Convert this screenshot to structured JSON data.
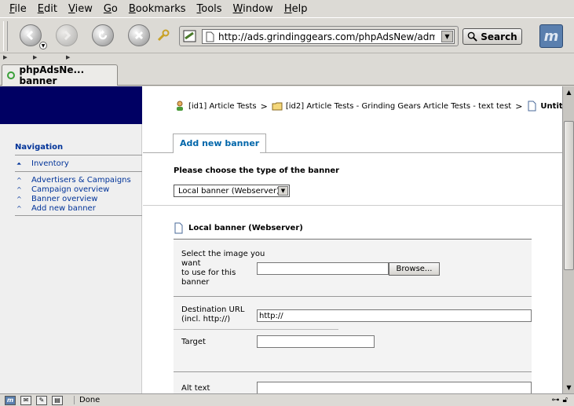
{
  "menu": {
    "items": [
      {
        "label": "File",
        "ul": "F",
        "rest": "ile"
      },
      {
        "label": "Edit",
        "ul": "E",
        "rest": "dit"
      },
      {
        "label": "View",
        "ul": "V",
        "rest": "iew"
      },
      {
        "label": "Go",
        "ul": "G",
        "rest": "o"
      },
      {
        "label": "Bookmarks",
        "ul": "B",
        "rest": "ookmarks"
      },
      {
        "label": "Tools",
        "ul": "T",
        "rest": "ools"
      },
      {
        "label": "Window",
        "ul": "W",
        "rest": "indow"
      },
      {
        "label": "Help",
        "ul": "H",
        "rest": "elp"
      }
    ]
  },
  "toolbar": {
    "url": "http://ads.grindinggears.com/phpAdsNew/admin/ba",
    "search_label": "Search",
    "throbber_icon": "mozilla-logo-icon",
    "throbber_glyph": "m"
  },
  "browser_tab": {
    "title": "phpAdsNe... banner"
  },
  "sidebar": {
    "title": "Navigation",
    "inventory": "Inventory",
    "links": [
      "Advertisers & Campaigns",
      "Campaign overview",
      "Banner overview",
      "Add new banner"
    ],
    "accent": "#000063"
  },
  "breadcrumb": {
    "advertiser": "[id1] Article Tests",
    "campaign": "[id2] Article Tests - Grinding Gears Article Tests - text test",
    "banner": "Untitled"
  },
  "page": {
    "tab_label": "Add new banner",
    "choose_label": "Please choose the type of the banner",
    "type_selected": "Local banner (Webserver)",
    "section_title": "Local banner (Webserver)"
  },
  "form": {
    "image_label_line1": "Select the image you",
    "image_label_line2": "want",
    "image_label_line3": "to use for this",
    "image_label_line4": "banner",
    "image_value": "",
    "browse_label": "Browse...",
    "dest_label_line1": "Destination URL",
    "dest_label_line2": "(incl. http://)",
    "dest_value": "http://",
    "target_label": "Target",
    "target_value": "",
    "alt_label": "Alt text",
    "alt_value": ""
  },
  "status": {
    "text": "Done"
  }
}
